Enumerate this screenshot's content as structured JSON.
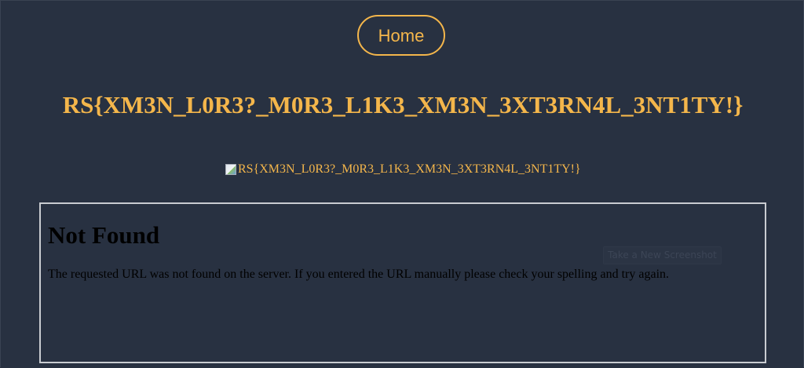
{
  "nav": {
    "home_label": "Home"
  },
  "flag_title": "RS{XM3N_L0R3?_M0R3_L1K3_XM3N_3XT3RN4L_3NT1TY!}",
  "image": {
    "alt_text": "RS{XM3N_L0R3?_M0R3_L1K3_XM3N_3XT3RN4L_3NT1TY!}",
    "icon": "broken-image-icon"
  },
  "embedded_page": {
    "heading": "Not Found",
    "message": "The requested URL was not found on the server. If you entered the URL manually please check your spelling and try again.",
    "screenshot_button_label": "Take a New Screenshot"
  },
  "colors": {
    "background": "#283141",
    "accent": "#f4b64b",
    "frame_border": "#c9ccd1",
    "error_text": "#000000"
  }
}
